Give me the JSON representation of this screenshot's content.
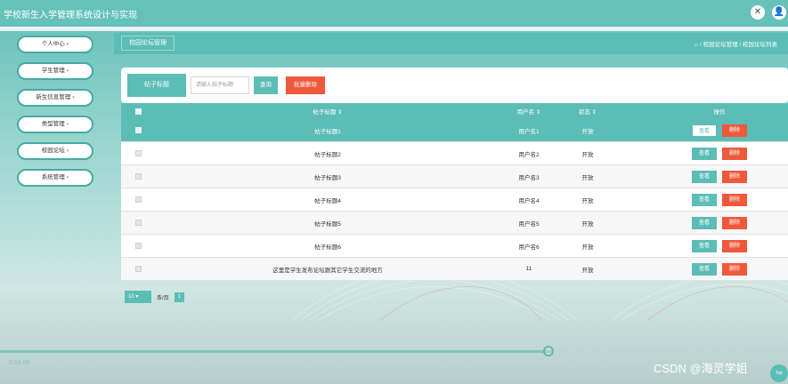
{
  "header": {
    "title": "学校新生入学管理系统设计与实现"
  },
  "sidebar": {
    "items": [
      {
        "label": "个人中心"
      },
      {
        "label": "学生管理"
      },
      {
        "label": "新生信息管理"
      },
      {
        "label": "类型管理"
      },
      {
        "label": "校园论坛"
      },
      {
        "label": "系统管理"
      }
    ]
  },
  "breadcrumb": {
    "tab": "校园论坛管理",
    "path": "⌂ / 校园论坛管理 / 校园论坛列表"
  },
  "search": {
    "label": "帖子标题",
    "placeholder": "请输入帖子标题",
    "query_btn": "查询",
    "bulk_delete_btn": "批量删除"
  },
  "table": {
    "headers": {
      "title": "帖子标题 ⇕",
      "user": "用户名 ⇕",
      "state": "状态 ⇕",
      "ops": "操作"
    },
    "rows": [
      {
        "title": "帖子标题1",
        "user": "用户名1",
        "state": "开放",
        "view": "查看",
        "del": "删除"
      },
      {
        "title": "帖子标题2",
        "user": "用户名2",
        "state": "开放",
        "view": "查看",
        "del": "删除"
      },
      {
        "title": "帖子标题3",
        "user": "用户名3",
        "state": "开放",
        "view": "查看",
        "del": "删除"
      },
      {
        "title": "帖子标题4",
        "user": "用户名4",
        "state": "开放",
        "view": "查看",
        "del": "删除"
      },
      {
        "title": "帖子标题5",
        "user": "用户名5",
        "state": "开放",
        "view": "查看",
        "del": "删除"
      },
      {
        "title": "帖子标题6",
        "user": "用户名6",
        "state": "开放",
        "view": "查看",
        "del": "删除"
      },
      {
        "title": "这里是学生发布论坛跟其它学生交流的地方",
        "user": "11",
        "state": "开放",
        "view": "查看",
        "del": "删除"
      }
    ]
  },
  "pager": {
    "page_size": "10",
    "per_page_label": "条/页",
    "current_page": "1"
  },
  "video": {
    "time": "0:04:06"
  },
  "watermark": "CSDN @海灵学姐",
  "top_button": "Top",
  "colors": {
    "primary": "#5cbdb6",
    "danger": "#f0583b"
  }
}
